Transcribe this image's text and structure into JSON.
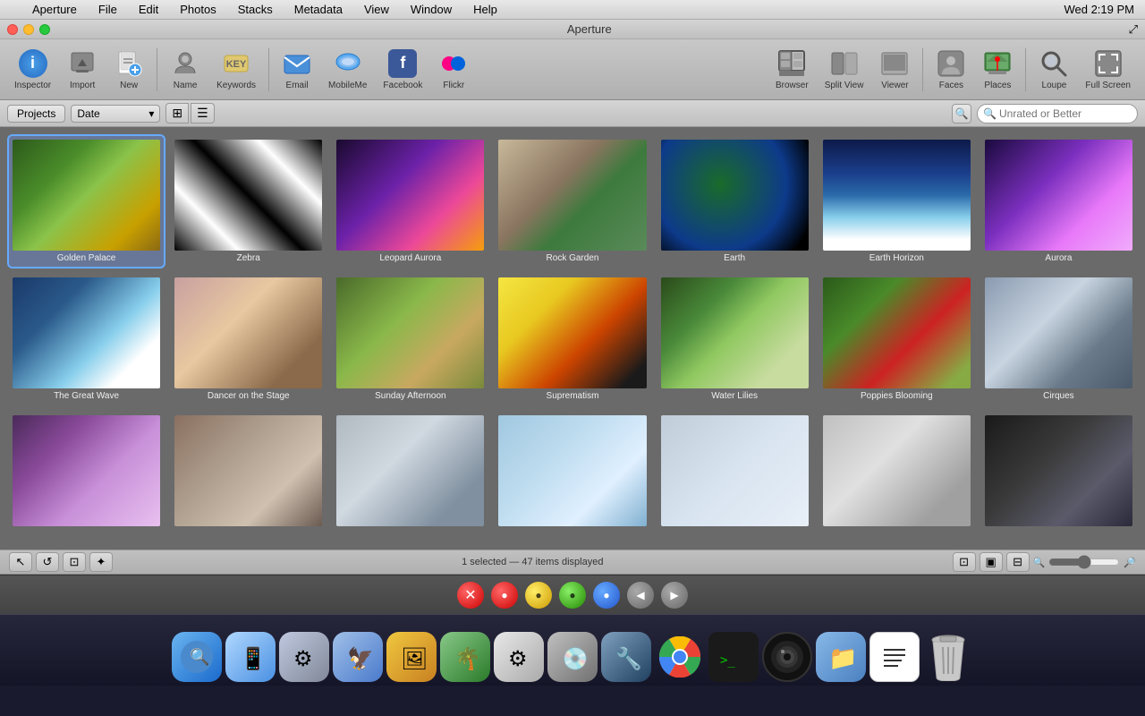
{
  "app": {
    "title": "Aperture",
    "time": "Wed 2:19 PM"
  },
  "menubar": {
    "apple": "",
    "items": [
      "Aperture",
      "File",
      "Edit",
      "Photos",
      "Stacks",
      "Metadata",
      "View",
      "Window",
      "Help"
    ]
  },
  "toolbar": {
    "buttons": [
      {
        "id": "inspector",
        "label": "Inspector",
        "icon": "ℹ"
      },
      {
        "id": "import",
        "label": "Import",
        "icon": "⬇"
      },
      {
        "id": "new",
        "label": "New",
        "icon": "📄"
      },
      {
        "id": "name",
        "label": "Name",
        "icon": "🏷"
      },
      {
        "id": "keywords",
        "label": "Keywords",
        "icon": "🔑"
      },
      {
        "id": "email",
        "label": "Email",
        "icon": "✉"
      },
      {
        "id": "mobileme",
        "label": "MobileMe",
        "icon": "☁"
      },
      {
        "id": "facebook",
        "label": "Facebook",
        "icon": "f"
      },
      {
        "id": "flickr",
        "label": "Flickr",
        "icon": "⬡"
      },
      {
        "id": "browser",
        "label": "Browser",
        "icon": "⊞"
      },
      {
        "id": "splitview",
        "label": "Split View",
        "icon": "⊟"
      },
      {
        "id": "viewer",
        "label": "Viewer",
        "icon": "▣"
      },
      {
        "id": "faces",
        "label": "Faces",
        "icon": "👤"
      },
      {
        "id": "places",
        "label": "Places",
        "icon": "📍"
      },
      {
        "id": "loupe",
        "label": "Loupe",
        "icon": "🔍"
      },
      {
        "id": "fullscreen",
        "label": "Full Screen",
        "icon": "⛶"
      }
    ]
  },
  "secondary_toolbar": {
    "breadcrumb": "Projects",
    "sort": "Date",
    "search_placeholder": "Unrated or Better"
  },
  "photos": [
    {
      "id": 1,
      "label": "Golden Palace",
      "thumb_class": "thumb-golden",
      "selected": true
    },
    {
      "id": 2,
      "label": "Zebra",
      "thumb_class": "thumb-zebra",
      "selected": false
    },
    {
      "id": 3,
      "label": "Leopard Aurora",
      "thumb_class": "thumb-aurora",
      "selected": false
    },
    {
      "id": 4,
      "label": "Rock Garden",
      "thumb_class": "thumb-rock",
      "selected": false
    },
    {
      "id": 5,
      "label": "Earth",
      "thumb_class": "thumb-earth",
      "selected": false
    },
    {
      "id": 6,
      "label": "Earth Horizon",
      "thumb_class": "thumb-earth-horizon",
      "selected": false
    },
    {
      "id": 7,
      "label": "Aurora",
      "thumb_class": "thumb-aurora2",
      "selected": false
    },
    {
      "id": 8,
      "label": "The Great Wave",
      "thumb_class": "thumb-wave",
      "selected": false
    },
    {
      "id": 9,
      "label": "Dancer on the Stage",
      "thumb_class": "thumb-dancer",
      "selected": false
    },
    {
      "id": 10,
      "label": "Sunday Afternoon",
      "thumb_class": "thumb-sunday",
      "selected": false
    },
    {
      "id": 11,
      "label": "Suprematism",
      "thumb_class": "thumb-suprematism",
      "selected": false
    },
    {
      "id": 12,
      "label": "Water Lilies",
      "thumb_class": "thumb-waterlilies",
      "selected": false
    },
    {
      "id": 13,
      "label": "Poppies Blooming",
      "thumb_class": "thumb-poppies",
      "selected": false
    },
    {
      "id": 14,
      "label": "Cirques",
      "thumb_class": "thumb-cirques",
      "selected": false
    },
    {
      "id": 15,
      "label": "",
      "thumb_class": "thumb-mountain",
      "selected": false
    },
    {
      "id": 16,
      "label": "",
      "thumb_class": "thumb-stones",
      "selected": false
    },
    {
      "id": 17,
      "label": "",
      "thumb_class": "thumb-sketch",
      "selected": false
    },
    {
      "id": 18,
      "label": "",
      "thumb_class": "thumb-glacier",
      "selected": false
    },
    {
      "id": 19,
      "label": "",
      "thumb_class": "thumb-mist",
      "selected": false
    },
    {
      "id": 20,
      "label": "",
      "thumb_class": "thumb-pebbles",
      "selected": false
    },
    {
      "id": 21,
      "label": "",
      "thumb_class": "thumb-dark-mountain",
      "selected": false
    }
  ],
  "status": {
    "text": "1 selected — 47 items displayed"
  },
  "playback": {
    "btn_reject": "✕",
    "btn_red": "●",
    "btn_yellow": "●",
    "btn_green": "●",
    "btn_blue": "●",
    "btn_prev": "◀",
    "btn_next": "▶"
  },
  "dock": {
    "items": [
      "🔍",
      "📱",
      "⚙",
      "🦅",
      "🖼",
      "🌴",
      "⚙",
      "💾",
      "🔧",
      "🌐",
      "💻",
      "📷",
      "📁",
      "📝",
      "🗑"
    ]
  }
}
